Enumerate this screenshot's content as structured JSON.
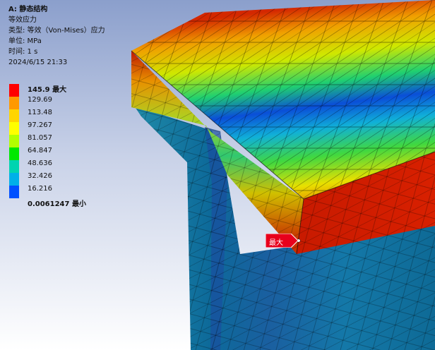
{
  "header": {
    "title": "A: 静态结构",
    "result_name": "等效应力",
    "type_line": "类型: 等效（Von-Mises）应力",
    "unit_line": "单位: MPa",
    "time_line": "时间: 1 s",
    "datetime": "2024/6/15 21:33"
  },
  "legend": {
    "entries": [
      {
        "value": "145.9 最大",
        "color": "#ff0000"
      },
      {
        "value": "129.69",
        "color": "#ff9900"
      },
      {
        "value": "113.48",
        "color": "#ffd500"
      },
      {
        "value": "97.267",
        "color": "#ffff00"
      },
      {
        "value": "81.057",
        "color": "#b2ff00"
      },
      {
        "value": "64.847",
        "color": "#00e800"
      },
      {
        "value": "48.636",
        "color": "#00d4b0"
      },
      {
        "value": "32.426",
        "color": "#00b0e8"
      },
      {
        "value": "16.216",
        "color": "#0050ff"
      },
      {
        "value": "0.0061247 最小",
        "color": null
      }
    ]
  },
  "probe": {
    "label": "最大",
    "color": "#e8001c"
  }
}
